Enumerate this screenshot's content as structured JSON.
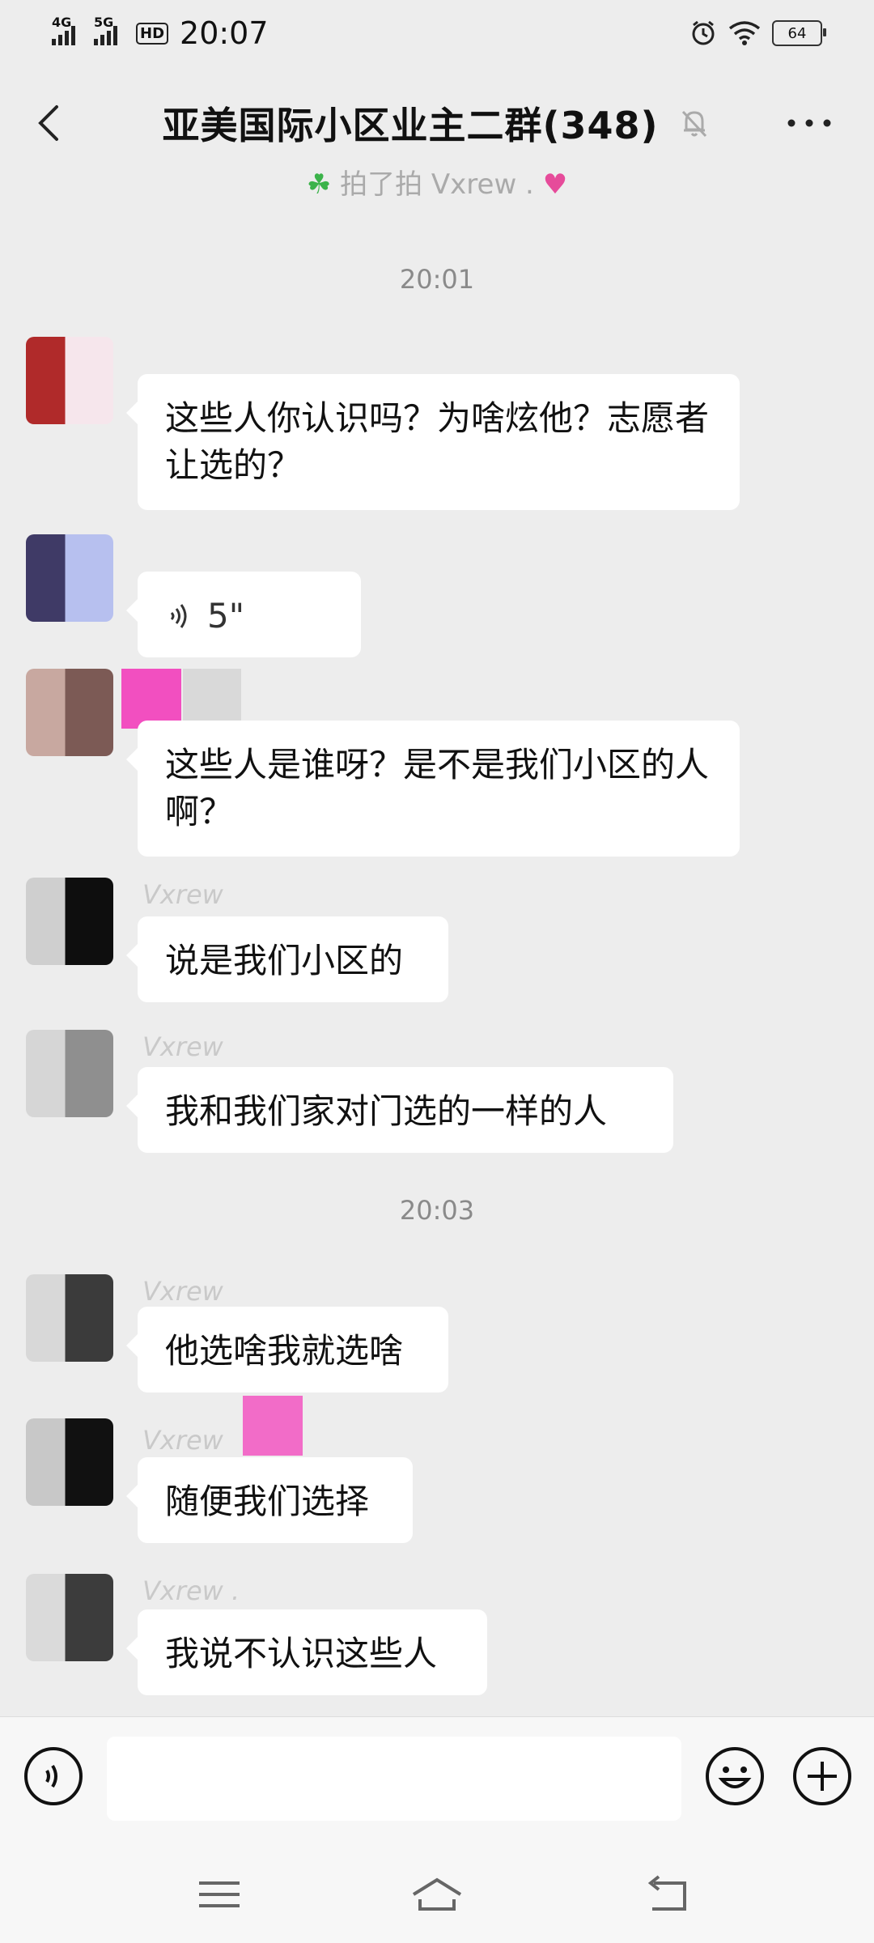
{
  "status": {
    "net1": "4G",
    "net2": "5G",
    "hd": "HD",
    "time": "20:07",
    "battery": "64"
  },
  "header": {
    "title": "亚美国际小区业主二群(348)"
  },
  "pat_notice": "拍了拍 Vxrew .",
  "messages": [
    {
      "time": "20:01"
    },
    {
      "text": "这些人你认识吗？为啥炫他？志愿者让选的？"
    },
    {
      "voice": "5\""
    },
    {
      "text": "这些人是谁呀？是不是我们小区的人啊？"
    },
    {
      "nick": "Vxrew",
      "text": "说是我们小区的"
    },
    {
      "nick": "Vxrew",
      "text": "我和我们家对门选的一样的人"
    },
    {
      "time": "20:03"
    },
    {
      "nick": "Vxrew",
      "text": "他选啥我就选啥"
    },
    {
      "nick": "Vxrew",
      "text": "随便我们选择"
    },
    {
      "nick": "Vxrew .",
      "text": "我说不认识这些人"
    }
  ],
  "colors": {
    "background": "#ededed",
    "bubble": "#ffffff",
    "composer": "#f7f7f7"
  }
}
